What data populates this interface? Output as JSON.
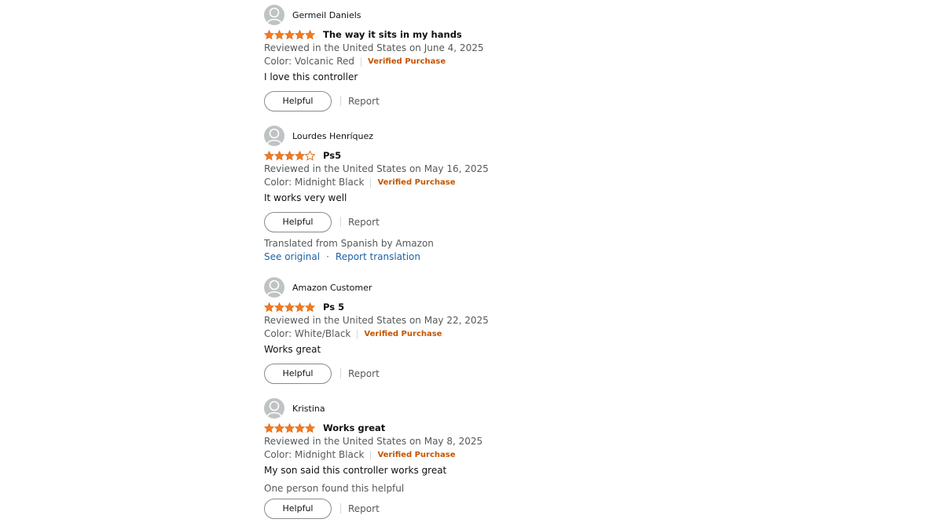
{
  "reviews": [
    {
      "profile_name": "Germeil Daniels",
      "rating": 5,
      "title": "The way it sits in my hands",
      "date_line": "Reviewed in the United States on June 4, 2025",
      "variant": "Color: Volcanic Red",
      "verified": "Verified Purchase",
      "body": "I love this controller",
      "helpful_label": "Helpful",
      "report_label": "Report"
    },
    {
      "profile_name": "Lourdes Henríquez",
      "rating": 4,
      "title": "Ps5",
      "date_line": "Reviewed in the United States on May 16, 2025",
      "variant": "Color: Midnight Black",
      "verified": "Verified Purchase",
      "body": "It works very well",
      "helpful_label": "Helpful",
      "report_label": "Report",
      "translated_note": "Translated from Spanish by Amazon",
      "see_original": "See original",
      "separator": "·",
      "report_translation": "Report translation"
    },
    {
      "profile_name": "Amazon Customer",
      "rating": 5,
      "title": "Ps 5",
      "date_line": "Reviewed in the United States on May 22, 2025",
      "variant": "Color: White/Black",
      "verified": "Verified Purchase",
      "body": "Works great",
      "helpful_label": "Helpful",
      "report_label": "Report"
    },
    {
      "profile_name": "Kristina",
      "rating": 5,
      "title": "Works great",
      "date_line": "Reviewed in the United States on May 8, 2025",
      "variant": "Color: Midnight Black",
      "verified": "Verified Purchase",
      "body": "My son said this controller works great",
      "helpful_count_text": "One person found this helpful",
      "helpful_label": "Helpful",
      "report_label": "Report"
    }
  ],
  "colors": {
    "star_fill": "#F47920",
    "verified": "#C45500",
    "link": "#2162a1"
  }
}
